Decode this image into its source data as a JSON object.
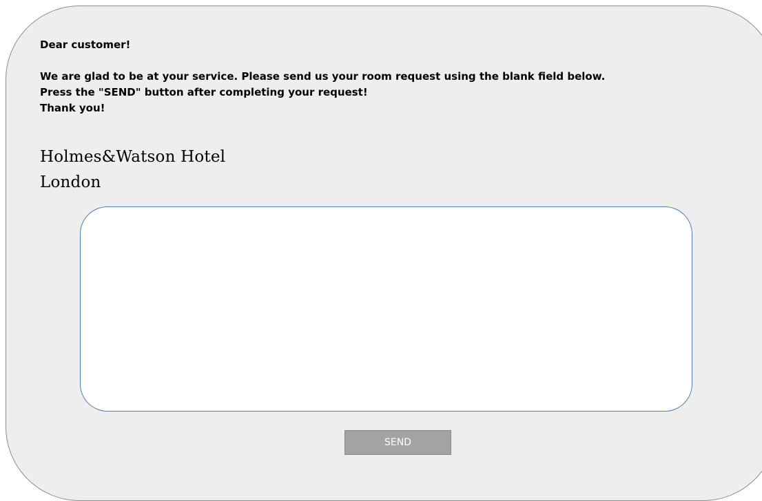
{
  "message": {
    "greeting": "Dear customer!",
    "line1": "We are glad to be at your service. Please send us your room request using the blank field below.",
    "line2": "Press the \"SEND\" button after completing your request!",
    "line3": "Thank you!"
  },
  "signature": {
    "hotel_name": "Holmes&Watson Hotel",
    "city": "London"
  },
  "request_field": {
    "value": "",
    "placeholder": ""
  },
  "send_button": {
    "label": "SEND"
  },
  "colors": {
    "panel_background": "#eeeeee",
    "field_border": "#4f7bb0",
    "button_background": "#a3a3a3",
    "button_text": "#ffffff"
  }
}
